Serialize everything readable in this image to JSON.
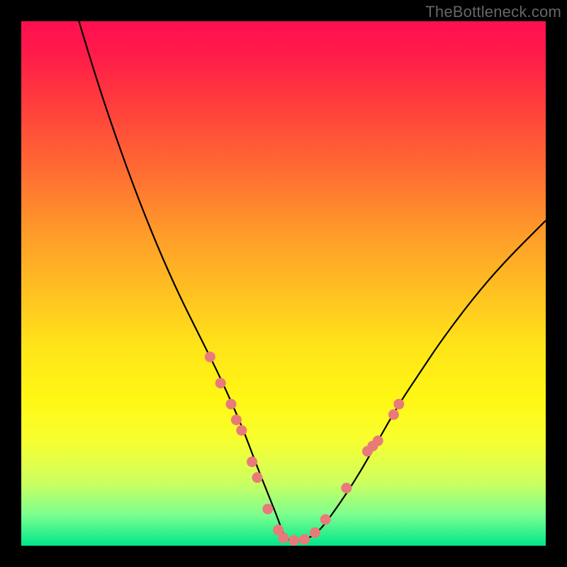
{
  "watermark": "TheBottleneck.com",
  "colors": {
    "frame": "#000000",
    "curve": "#000000",
    "dots": "#e97a7a",
    "gradient_top": "#ff1050",
    "gradient_bottom": "#00e68a"
  },
  "chart_data": {
    "type": "line",
    "title": "",
    "xlabel": "",
    "ylabel": "",
    "xlim": [
      0,
      100
    ],
    "ylim": [
      0,
      100
    ],
    "grid": false,
    "legend": false,
    "annotations": [
      "TheBottleneck.com"
    ],
    "series": [
      {
        "name": "curve",
        "x": [
          11,
          14,
          18,
          22,
          26,
          30,
          34,
          38,
          42,
          45,
          47,
          49,
          50,
          51,
          53,
          55,
          57,
          60,
          64,
          68,
          72,
          76,
          80,
          86,
          92,
          100
        ],
        "y": [
          100,
          90,
          78,
          67,
          57,
          48,
          40,
          32,
          23,
          15,
          10,
          5,
          2,
          1,
          1,
          1.5,
          3,
          7,
          13,
          20,
          27,
          33,
          39,
          47,
          54,
          62
        ]
      }
    ],
    "markers": [
      {
        "x": 36,
        "y": 36
      },
      {
        "x": 38,
        "y": 31
      },
      {
        "x": 40,
        "y": 27
      },
      {
        "x": 41,
        "y": 24
      },
      {
        "x": 42,
        "y": 22
      },
      {
        "x": 44,
        "y": 16
      },
      {
        "x": 45,
        "y": 13
      },
      {
        "x": 47,
        "y": 7
      },
      {
        "x": 49,
        "y": 3
      },
      {
        "x": 50,
        "y": 1.5
      },
      {
        "x": 52,
        "y": 1
      },
      {
        "x": 54,
        "y": 1.2
      },
      {
        "x": 56,
        "y": 2.5
      },
      {
        "x": 58,
        "y": 5
      },
      {
        "x": 62,
        "y": 11
      },
      {
        "x": 66,
        "y": 18
      },
      {
        "x": 67,
        "y": 19
      },
      {
        "x": 68,
        "y": 20
      },
      {
        "x": 71,
        "y": 25
      },
      {
        "x": 72,
        "y": 27
      }
    ]
  }
}
